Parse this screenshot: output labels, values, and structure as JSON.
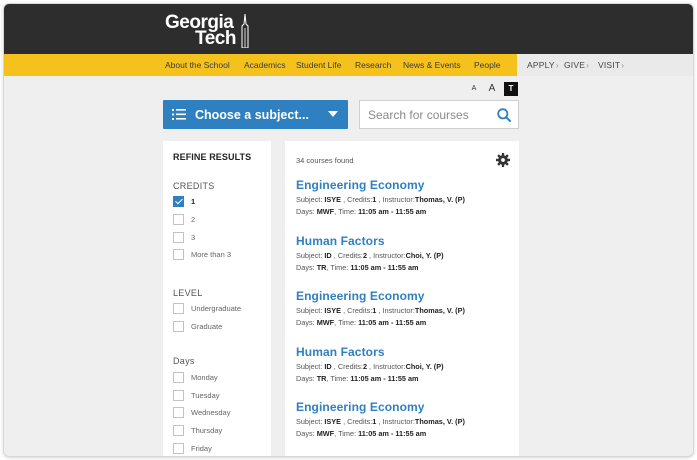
{
  "header": {
    "logo_line1": "Georgia",
    "logo_line2": "Tech"
  },
  "nav": {
    "items": [
      "About the School",
      "Academics",
      "Student Life",
      "Research",
      "News & Events",
      "People"
    ],
    "utility": [
      "APPLY",
      "GIVE",
      "VISIT"
    ]
  },
  "text_size": {
    "small": "A",
    "medium": "A",
    "large": "T"
  },
  "subject": {
    "label": "Choose a subject..."
  },
  "search": {
    "placeholder": "Search for courses"
  },
  "refine": {
    "title": "REFINE RESULTS",
    "credits": {
      "title": "CREDITS",
      "options": [
        {
          "label": "1",
          "checked": true
        },
        {
          "label": "2",
          "checked": false
        },
        {
          "label": "3",
          "checked": false
        },
        {
          "label": "More than 3",
          "checked": false
        }
      ]
    },
    "level": {
      "title": "LEVEL",
      "options": [
        {
          "label": "Undergraduate",
          "checked": false
        },
        {
          "label": "Graduate",
          "checked": false
        }
      ]
    },
    "days": {
      "title": "Days",
      "options": [
        {
          "label": "Monday",
          "checked": false
        },
        {
          "label": "Tuesday",
          "checked": false
        },
        {
          "label": "Wednesday",
          "checked": false
        },
        {
          "label": "Thursday",
          "checked": false
        },
        {
          "label": "Friday",
          "checked": false
        }
      ]
    }
  },
  "results": {
    "count_text": "34 courses found",
    "labels": {
      "subject": "Subject:",
      "credits": "Credits:",
      "instructor": "Instructor:",
      "days": "Days:",
      "time": "Time:"
    },
    "courses": [
      {
        "title": "Engineering Economy",
        "subject": "ISYE",
        "credits": "1",
        "instructor": "Thomas, V. (P)",
        "days": "MWF",
        "time": "11:05 am - 11:55 am"
      },
      {
        "title": "Human Factors",
        "subject": "ID",
        "credits": "2",
        "instructor": "Choi, Y. (P)",
        "days": "TR",
        "time": "11:05 am - 11:55 am"
      },
      {
        "title": "Engineering Economy",
        "subject": "ISYE",
        "credits": "1",
        "instructor": "Thomas, V. (P)",
        "days": "MWF",
        "time": "11:05 am - 11:55 am"
      },
      {
        "title": "Human Factors",
        "subject": "ID",
        "credits": "2",
        "instructor": "Choi, Y. (P)",
        "days": "TR",
        "time": "11:05 am - 11:55 am"
      },
      {
        "title": "Engineering Economy",
        "subject": "ISYE",
        "credits": "1",
        "instructor": "Thomas, V. (P)",
        "days": "MWF",
        "time": "11:05 am - 11:55 am"
      }
    ]
  },
  "colors": {
    "brand_gold": "#f5c21d",
    "header_dark": "#2d2d2d",
    "accent_blue": "#2f80c0"
  }
}
